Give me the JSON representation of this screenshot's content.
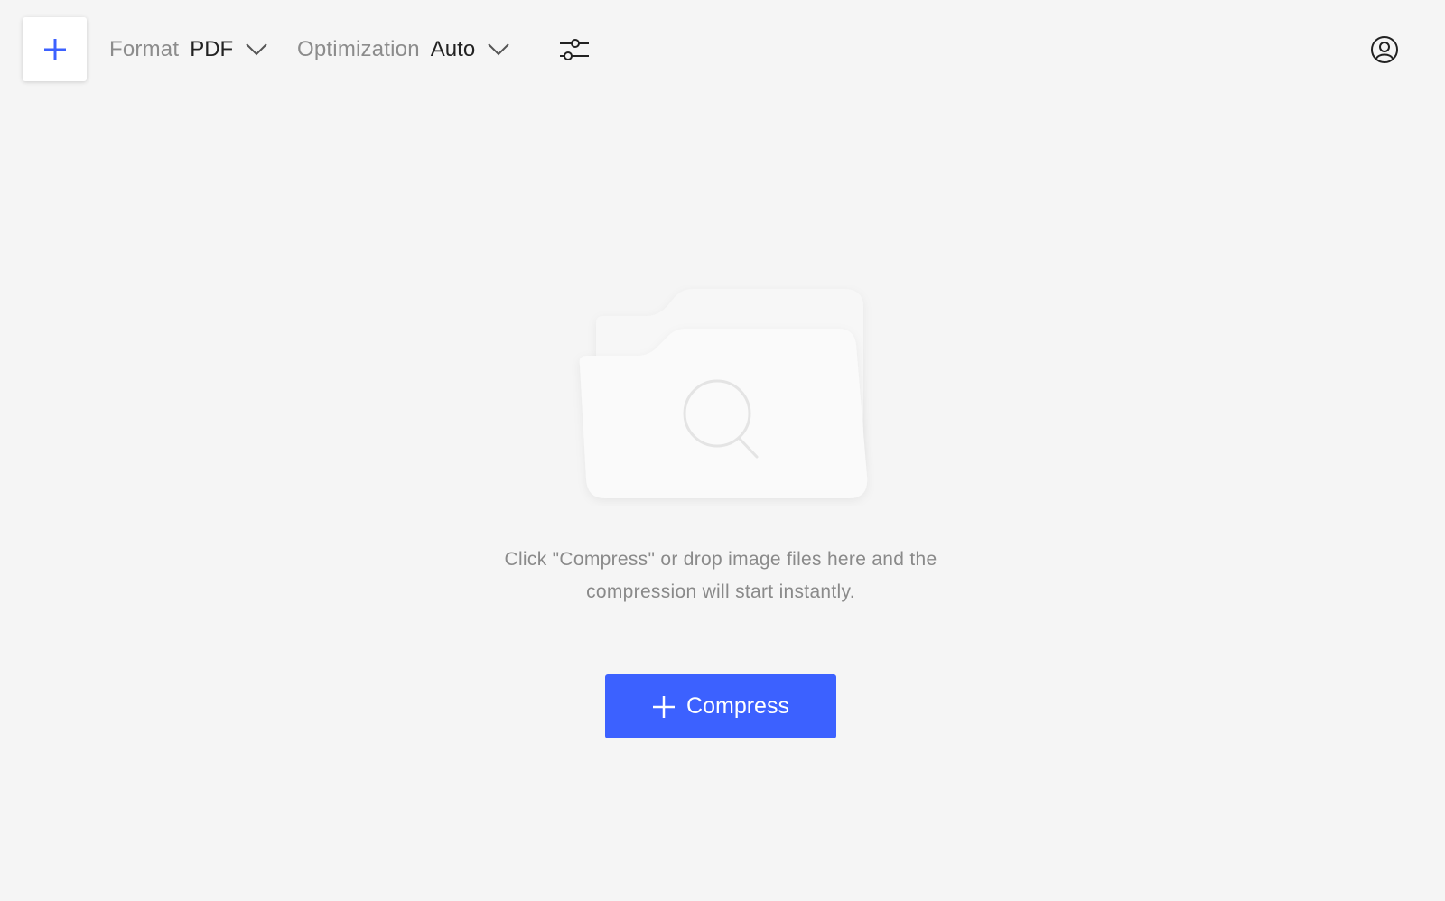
{
  "colors": {
    "background": "#f5f5f5",
    "accent": "#3c61ff",
    "text_muted": "#8c8c8c",
    "text_dark": "#222222"
  },
  "toolbar": {
    "add_button_icon": "plus-icon",
    "format": {
      "label": "Format",
      "value": "PDF",
      "icon": "chevron-down-icon"
    },
    "optimization": {
      "label": "Optimization",
      "value": "Auto",
      "icon": "chevron-down-icon"
    },
    "settings_icon": "sliders-icon",
    "account_icon": "user-circle-icon"
  },
  "main": {
    "illustration_icon": "folder-search-icon",
    "hint_line1": "Click \"Compress\" or drop image files here and the",
    "hint_line2": "compression will start instantly.",
    "compress_button": {
      "label": "Compress",
      "icon": "plus-icon"
    }
  }
}
